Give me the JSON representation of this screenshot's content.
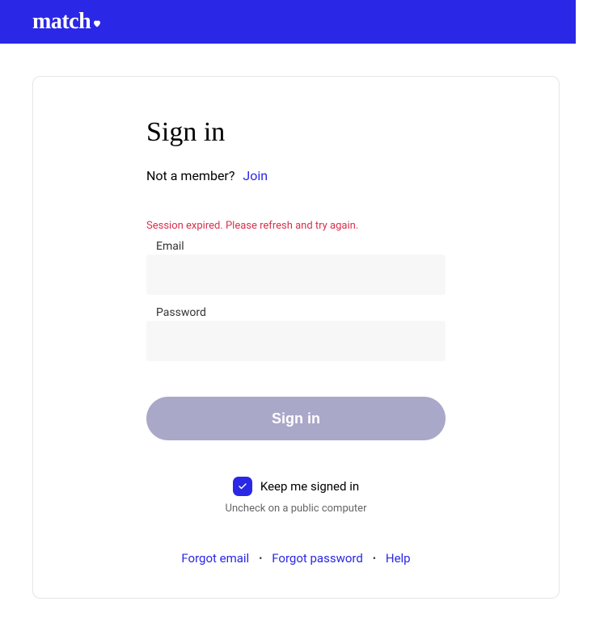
{
  "header": {
    "logo_text": "match"
  },
  "signin": {
    "title": "Sign in",
    "not_member_text": "Not a member?",
    "join_label": "Join",
    "error_message": "Session expired. Please refresh and try again.",
    "email_label": "Email",
    "email_value": "",
    "password_label": "Password",
    "password_value": "",
    "button_label": "Sign in",
    "keep_signed_label": "Keep me signed in",
    "keep_signed_checked": true,
    "uncheck_note": "Uncheck on a public computer"
  },
  "footer": {
    "forgot_email": "Forgot email",
    "forgot_password": "Forgot password",
    "help": "Help"
  }
}
